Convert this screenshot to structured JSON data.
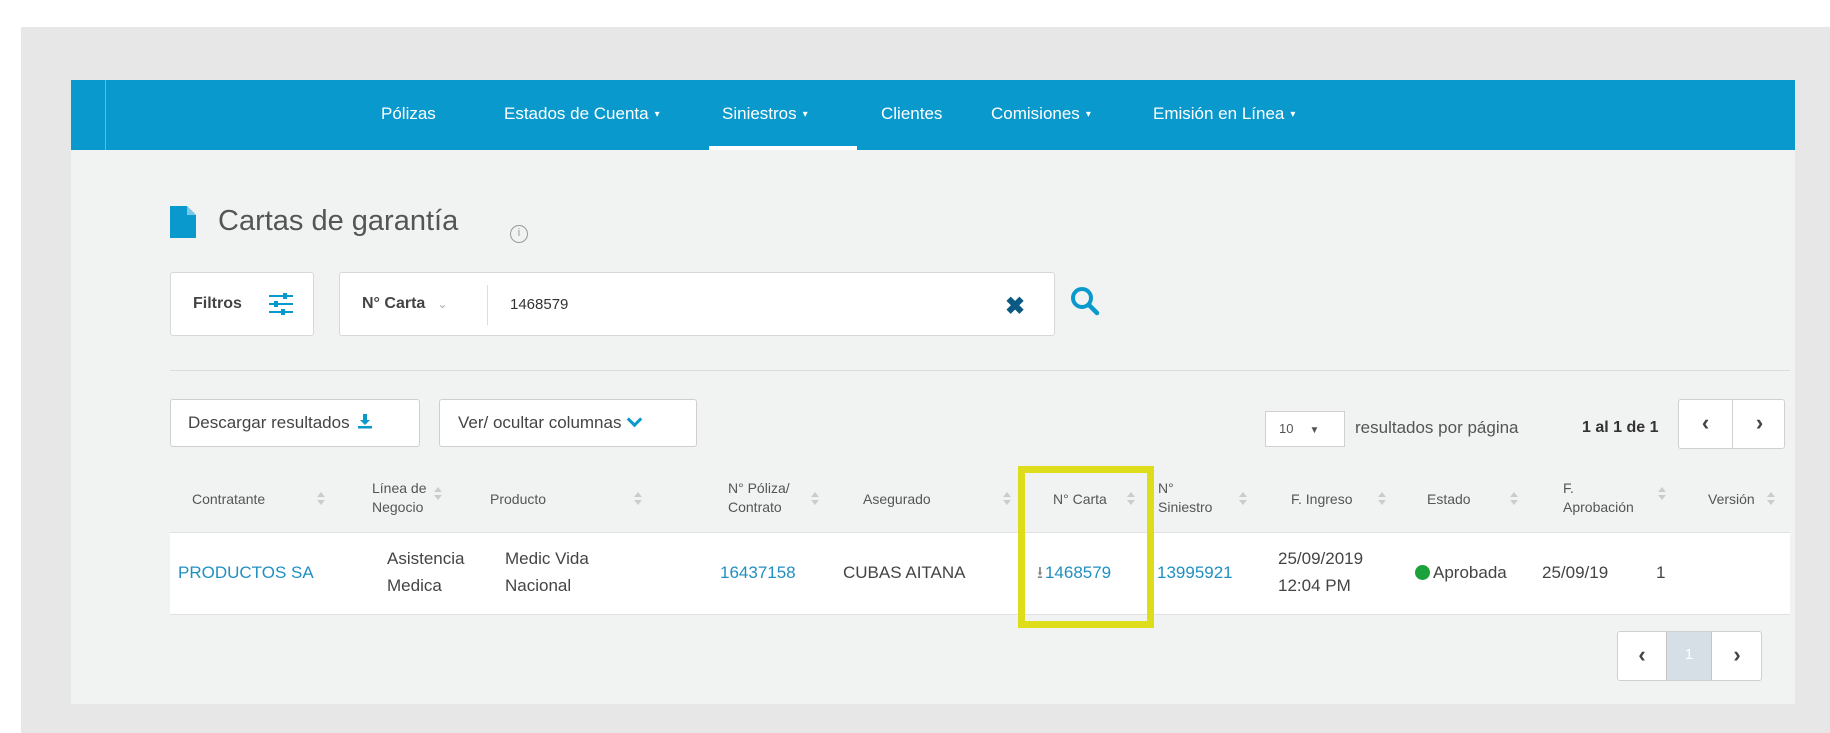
{
  "nav": {
    "items": [
      {
        "label": "Pólizas",
        "dropdown": false,
        "active": false
      },
      {
        "label": "Estados de Cuenta",
        "dropdown": true,
        "active": false
      },
      {
        "label": "Siniestros",
        "dropdown": true,
        "active": true
      },
      {
        "label": "Clientes",
        "dropdown": false,
        "active": false
      },
      {
        "label": "Comisiones",
        "dropdown": true,
        "active": false
      },
      {
        "label": "Emisión en Línea",
        "dropdown": true,
        "active": false
      }
    ],
    "caret": "▾",
    "color": "#0a99cc"
  },
  "page": {
    "title": "Cartas de garantía",
    "title_icon": "document-icon",
    "info_glyph": "i"
  },
  "filters": {
    "button_label": "Filtros",
    "field_label": "N° Carta",
    "field_chevron": "⌄",
    "search_value": "1468579",
    "clear_glyph": "✖"
  },
  "actions": {
    "download_label": "Descargar resultados",
    "columns_label": "Ver/ ocultar columnas",
    "per_page_value": "10",
    "per_page_caret": "▼",
    "per_page_label": "resultados por página",
    "range_label": "1 al 1 de 1",
    "prev_glyph": "‹",
    "next_glyph": "›"
  },
  "table": {
    "columns": [
      {
        "line1": "Contratante",
        "line2": ""
      },
      {
        "line1": "Línea de",
        "line2": "Negocio"
      },
      {
        "line1": "Producto",
        "line2": ""
      },
      {
        "line1": "N° Póliza/",
        "line2": "Contrato"
      },
      {
        "line1": "Asegurado",
        "line2": ""
      },
      {
        "line1": "N° Carta",
        "line2": ""
      },
      {
        "line1": "N°",
        "line2": "Siniestro"
      },
      {
        "line1": "F. Ingreso",
        "line2": ""
      },
      {
        "line1": "Estado",
        "line2": ""
      },
      {
        "line1": "F.",
        "line2": "Aprobación"
      },
      {
        "line1": "Versión",
        "line2": ""
      }
    ],
    "rows": [
      {
        "contratante": "PRODUCTOS SA",
        "linea_1": "Asistencia",
        "linea_2": "Medica",
        "producto_1": "Medic Vida",
        "producto_2": "Nacional",
        "poliza": "16437158",
        "asegurado": "CUBAS  AITANA",
        "carta_icon": "⭳",
        "carta": "1468579",
        "siniestro": "13995921",
        "ingreso_fecha": "25/09/2019",
        "ingreso_hora": "12:04 PM",
        "estado": "Aprobada",
        "estado_color": "#1ca23b",
        "aprobacion": "25/09/19",
        "version": "1"
      }
    ]
  },
  "pagination": {
    "current_page": "1"
  },
  "highlight_color": "#dedd1c"
}
